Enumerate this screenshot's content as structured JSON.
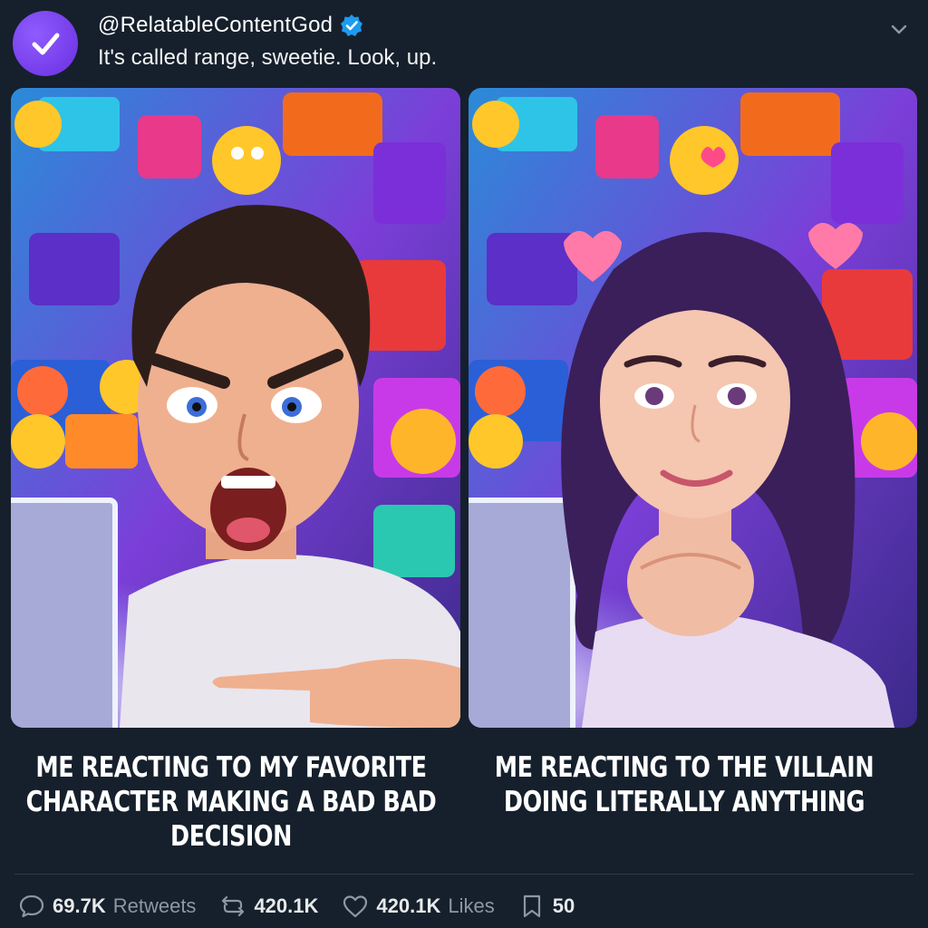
{
  "tweet": {
    "handle": "@RelatableContentGod",
    "text": "It's called range, sweetie. Look, up.",
    "verified": true
  },
  "panels": [
    {
      "caption": "ME REACTING TO MY FAVORITE CHARACTER MAKING A BAD BAD DECISION"
    },
    {
      "caption": "ME REACTING TO THE VILLAIN DOING LITERALLY ANYTHING"
    }
  ],
  "actions": {
    "reply": {
      "count": "69.7K",
      "label": "Retweets",
      "icon": "reply-icon"
    },
    "retweet": {
      "count": "420.1K",
      "icon": "retweet-icon"
    },
    "like": {
      "count": "420.1K",
      "label": "Likes",
      "icon": "heart-icon"
    },
    "bookmark": {
      "count": "50",
      "icon": "bookmark-icon"
    }
  },
  "colors": {
    "background": "#16202c",
    "avatar": "#7b45f0",
    "verified": "#1d9bf0",
    "muted_text": "#8b98a5"
  }
}
